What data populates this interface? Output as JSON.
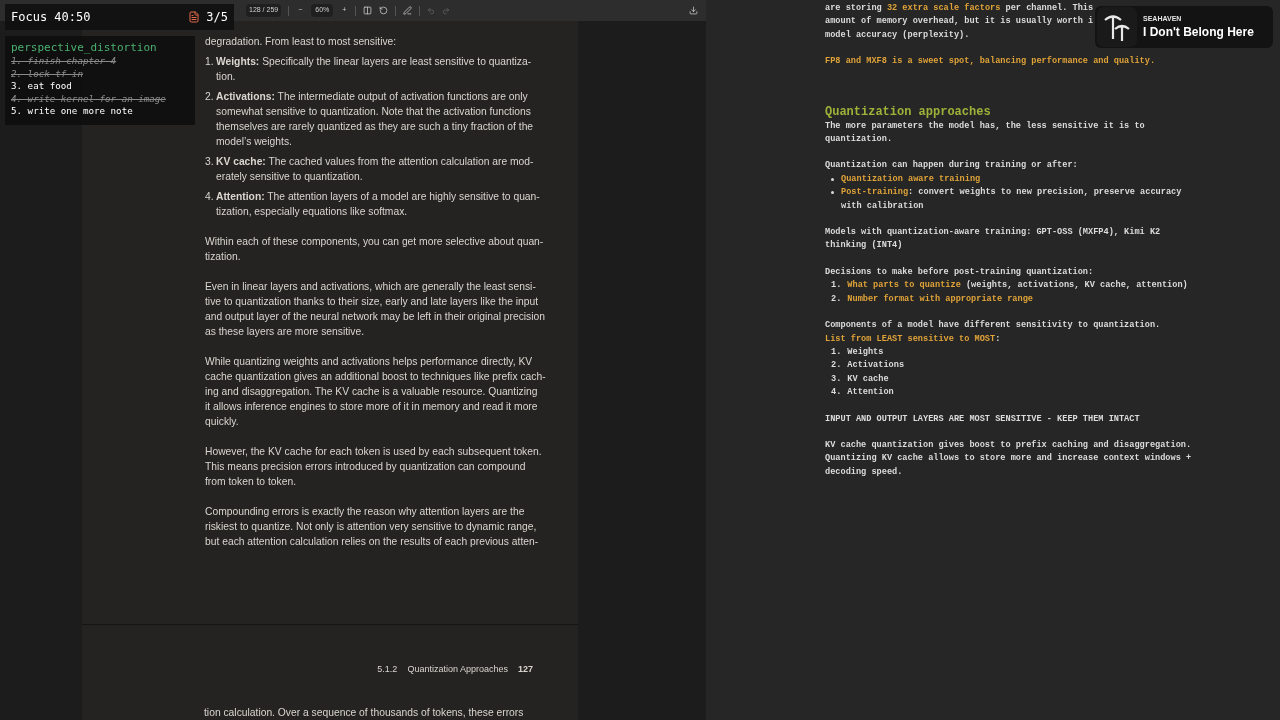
{
  "focus_timer": {
    "label": "Focus 40:50",
    "progress": "3/5"
  },
  "todo": {
    "title": "perspective_distortion",
    "items": [
      {
        "text": "1. finish chapter 4",
        "done": true
      },
      {
        "text": "2. lock tf in",
        "done": true
      },
      {
        "text": "3. eat food",
        "done": false
      },
      {
        "text": "4. write kernel for an image",
        "done": true
      },
      {
        "text": "5. write one more note",
        "done": false
      }
    ]
  },
  "pdf_toolbar": {
    "page": "128 / 259",
    "zoom_out": "−",
    "zoom": "60%",
    "zoom_in": "+",
    "undo_disabled": true,
    "redo_disabled": true
  },
  "pdf_page": {
    "blocks": [
      {
        "kind": "paragraph",
        "lines": [
          "degradation. From least to most sensitive:"
        ]
      },
      {
        "kind": "item",
        "number": "1.",
        "lines": [
          "**Weights:** Specifically the linear layers are least sensitive to quantiza-",
          "tion."
        ]
      },
      {
        "kind": "item",
        "number": "2.",
        "lines": [
          "**Activations:** The intermediate output of activation functions are only",
          "somewhat sensitive to quantization. Note that the activation functions",
          "themselves are rarely quantized as they are such a tiny fraction of the",
          "model’s weights."
        ]
      },
      {
        "kind": "item",
        "number": "3.",
        "lines": [
          "**KV cache:** The cached values from the attention calculation are mod-",
          "erately sensitive to quantization."
        ]
      },
      {
        "kind": "item",
        "number": "4.",
        "lines": [
          "**Attention:** The attention layers of a model are highly sensitive to quan-",
          "tization, especially equations like softmax."
        ]
      },
      {
        "kind": "paragraph",
        "lines": [
          "Within each of these components, you can get more selective about quan-",
          "tization."
        ]
      },
      {
        "kind": "paragraph",
        "lines": [
          "Even in linear layers and activations, which are generally the least sensi-",
          "tive to quantization thanks to their size, early and late layers like the input",
          "and output layer of the neural network may be left in their original precision",
          "as these layers are more sensitive."
        ]
      },
      {
        "kind": "paragraph",
        "lines": [
          "While quantizing weights and activations helps performance directly, KV",
          "cache quantization gives an additional boost to techniques like prefix cach-",
          "ing and disaggregation. The KV cache is a valuable resource. Quantizing",
          "it allows inference engines to store more of it in memory and read it more",
          "quickly."
        ]
      },
      {
        "kind": "paragraph",
        "lines": [
          "However, the KV cache for each token is used by each subsequent token.",
          "This means precision errors introduced by quantization can compound",
          "from token to token."
        ]
      },
      {
        "kind": "paragraph",
        "lines": [
          "Compounding errors is exactly the reason why attention layers are the",
          "riskiest to quantize. Not only is attention very sensitive to dynamic range,",
          "but each attention calculation relies on the results of each previous atten-"
        ]
      }
    ],
    "footer_section": "5.1.2",
    "footer_title": "Quantization Approaches",
    "footer_page": "127",
    "next_page_line": "tion calculation. Over a sequence of thousands of tokens, these errors"
  },
  "now_playing": {
    "artist": "SEAHAVEN",
    "title": "I Don't Belong Here"
  },
  "notes": [
    {
      "blocks": [
        {
          "kind": "paragraph",
          "lines": [
            [
              {
                "t": "are storing ",
                "hl": false
              },
              {
                "t": "32 extra scale factors",
                "hl": true
              },
              {
                "t": " per channel. This",
                "hl": false
              }
            ],
            [
              {
                "t": "amount of memory overhead, but it is usually worth i"
              }
            ],
            [
              {
                "t": "model accuracy (perplexity)."
              }
            ]
          ]
        }
      ]
    },
    {
      "blocks": [
        {
          "kind": "paragraph",
          "lines": [
            [
              {
                "t": "FP8 and MXF8 is a sweet spot, balancing performance and quality.",
                "hl": true
              }
            ]
          ]
        }
      ]
    },
    {
      "blocks": [
        {
          "kind": "heading",
          "text": "Quantization approaches"
        },
        {
          "kind": "paragraph",
          "lines": [
            [
              {
                "t": "The more parameters the model has, the less sensitive it is to"
              }
            ],
            [
              {
                "t": "quantization."
              }
            ]
          ]
        }
      ]
    },
    {
      "blocks": [
        {
          "kind": "paragraph",
          "lines": [
            [
              {
                "t": "Quantization can happen during training or after:"
              }
            ]
          ]
        },
        {
          "kind": "bullet",
          "lines": [
            [
              {
                "t": "Quantization aware training",
                "hl": true
              }
            ]
          ]
        },
        {
          "kind": "bullet",
          "lines": [
            [
              {
                "t": "Post-training",
                "hl": true
              },
              {
                "t": ": convert weights to new precision, preserve accuracy",
                "hl": false
              }
            ],
            [
              {
                "t": "with calibration"
              }
            ]
          ]
        }
      ]
    },
    {
      "blocks": [
        {
          "kind": "paragraph",
          "lines": [
            [
              {
                "t": "Models with quantization-aware training: GPT-OSS (MXFP4), Kimi K2"
              }
            ],
            [
              {
                "t": "thinking (INT4)"
              }
            ]
          ]
        }
      ]
    },
    {
      "blocks": [
        {
          "kind": "paragraph",
          "lines": [
            [
              {
                "t": "Decisions to make before post-training quantization:"
              }
            ]
          ]
        },
        {
          "kind": "numbered",
          "number": "1.",
          "lines": [
            [
              {
                "t": "What parts to quantize",
                "hl": true
              },
              {
                "t": " (weights, activations, KV cache, attention)",
                "hl": false
              }
            ]
          ]
        },
        {
          "kind": "numbered",
          "number": "2.",
          "lines": [
            [
              {
                "t": "Number format with appropriate range",
                "hl": true
              }
            ]
          ]
        }
      ]
    },
    {
      "blocks": [
        {
          "kind": "paragraph",
          "lines": [
            [
              {
                "t": "Components of a model have different sensitivity to quantization."
              }
            ],
            [
              {
                "t": "List from LEAST sensitive to MOST",
                "hl": true
              },
              {
                "t": ":",
                "hl": false
              }
            ]
          ]
        },
        {
          "kind": "numbered",
          "number": "1.",
          "lines": [
            [
              {
                "t": "Weights"
              }
            ]
          ]
        },
        {
          "kind": "numbered",
          "number": "2.",
          "lines": [
            [
              {
                "t": "Activations"
              }
            ]
          ]
        },
        {
          "kind": "numbered",
          "number": "3.",
          "lines": [
            [
              {
                "t": "KV cache"
              }
            ]
          ]
        },
        {
          "kind": "numbered",
          "number": "4.",
          "lines": [
            [
              {
                "t": "Attention"
              }
            ]
          ]
        }
      ]
    },
    {
      "blocks": [
        {
          "kind": "paragraph",
          "lines": [
            [
              {
                "t": "INPUT AND OUTPUT LAYERS ARE MOST SENSITIVE - KEEP THEM INTACT"
              }
            ]
          ]
        }
      ]
    },
    {
      "blocks": [
        {
          "kind": "paragraph",
          "lines": [
            [
              {
                "t": "KV cache quantization gives boost to prefix caching and disaggregation."
              }
            ],
            [
              {
                "t": "Quantizing KV cache allows to store more and increase context windows +"
              }
            ],
            [
              {
                "t": "decoding speed."
              }
            ]
          ]
        }
      ]
    }
  ]
}
